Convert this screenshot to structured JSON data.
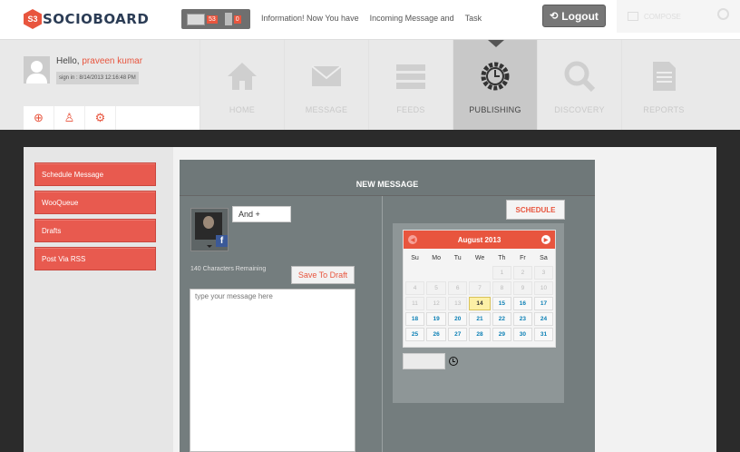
{
  "brand": {
    "logo_mark": "S3",
    "name": "SOCIOBOARD"
  },
  "header": {
    "message_count": "53",
    "trash_count": "0",
    "links": [
      "Information! Now You have",
      "Incoming Message and",
      "Task"
    ],
    "logout_label": "Logout",
    "compose_label": "COMPOSE"
  },
  "user": {
    "hello": "Hello,",
    "name": "praveen kumar",
    "signin": "sign in : 8/14/2013 12:16:48 PM"
  },
  "nav": [
    {
      "label": "HOME",
      "icon": "home-icon"
    },
    {
      "label": "MESSAGE",
      "icon": "envelope-icon"
    },
    {
      "label": "FEEDS",
      "icon": "feeds-icon"
    },
    {
      "label": "PUBLISHING",
      "icon": "clock-gear-icon",
      "active": true
    },
    {
      "label": "DISCOVERY",
      "icon": "magnifier-icon"
    },
    {
      "label": "REPORTS",
      "icon": "document-icon"
    }
  ],
  "sidebar": [
    "Schedule Message",
    "WooQueue",
    "Drafts",
    "Post Via RSS"
  ],
  "panel": {
    "title": "NEW MESSAGE",
    "and_label": "And +",
    "chars_remaining": "140 Characters Remaining",
    "save_draft": "Save To Draft",
    "message_placeholder": "type your message here",
    "schedule_label": "SCHEDULE"
  },
  "calendar": {
    "month": "August 2013",
    "weekdays": [
      "Su",
      "Mo",
      "Tu",
      "We",
      "Th",
      "Fr",
      "Sa"
    ],
    "today": 14,
    "rows": [
      [
        "",
        "",
        "",
        "",
        "1",
        "2",
        "3"
      ],
      [
        "4",
        "5",
        "6",
        "7",
        "8",
        "9",
        "10"
      ],
      [
        "11",
        "12",
        "13",
        "14",
        "15",
        "16",
        "17"
      ],
      [
        "18",
        "19",
        "20",
        "21",
        "22",
        "23",
        "24"
      ],
      [
        "25",
        "26",
        "27",
        "28",
        "29",
        "30",
        "31"
      ]
    ]
  },
  "colors": {
    "accent": "#e8553e",
    "panel": "#747d7e",
    "facebook": "#3b5998"
  }
}
